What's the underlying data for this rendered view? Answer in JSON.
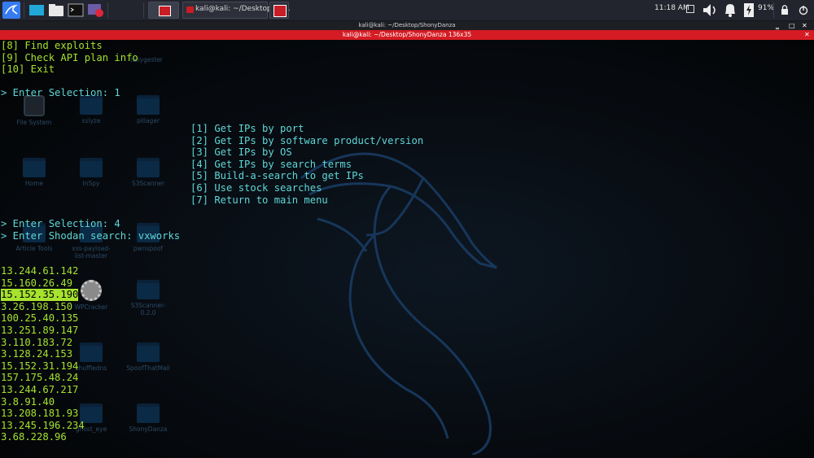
{
  "taskbar": {
    "task_title": "kali@kali: ~/Desktop/Sh...",
    "clock": "11:18 AM",
    "battery": "91%"
  },
  "window": {
    "outer_title": "kali@kali: ~/Desktop/ShonyDanza",
    "terminal_title": "kali@kali: ~/Desktop/ShonyDanza 136x35"
  },
  "desktop_icons": [
    {
      "label": "File System"
    },
    {
      "label": "sslyze"
    },
    {
      "label": "pillager"
    },
    {
      "label": "Home"
    },
    {
      "label": "InSpy"
    },
    {
      "label": "S3Scanner"
    },
    {
      "label": "Article Tools"
    },
    {
      "label": "xss-payload-list-master"
    },
    {
      "label": "pwnspoof"
    },
    {
      "label": "WPCracker"
    },
    {
      "label": "S3Scanner-0.2.0"
    },
    {
      "label": "shuffledns"
    },
    {
      "label": "SpoofThatMail"
    },
    {
      "label": "ghost_eye"
    },
    {
      "label": "ShonyDanza"
    },
    {
      "label": "tallygester"
    }
  ],
  "menu_top": [
    "[8] Find exploits",
    "[9] Check API plan info",
    "[10] Exit"
  ],
  "prompt1": "> Enter Selection: 1",
  "submenu": [
    "[1] Get IPs by port",
    "[2] Get IPs by software product/version",
    "[3] Get IPs by OS",
    "[4] Get IPs by search terms",
    "[5] Build-a-search to get IPs",
    "[6] Use stock searches",
    "[7] Return to main menu"
  ],
  "prompt2": "> Enter Selection: 4",
  "prompt3": "> Enter Shodan search: vxworks",
  "ips": [
    "13.244.61.142",
    "15.160.26.49",
    "15.152.35.190",
    "3.26.198.150",
    "100.25.40.135",
    "13.251.89.147",
    "3.110.183.72",
    "3.128.24.153",
    "15.152.31.194",
    "157.175.48.24",
    "13.244.67.217",
    "3.8.91.40",
    "13.208.181.93",
    "13.245.196.234",
    "3.68.228.96"
  ],
  "colors": {
    "prompt": "#5fd7d7",
    "output": "#a6e22e",
    "title_bar": "#d51b23"
  }
}
